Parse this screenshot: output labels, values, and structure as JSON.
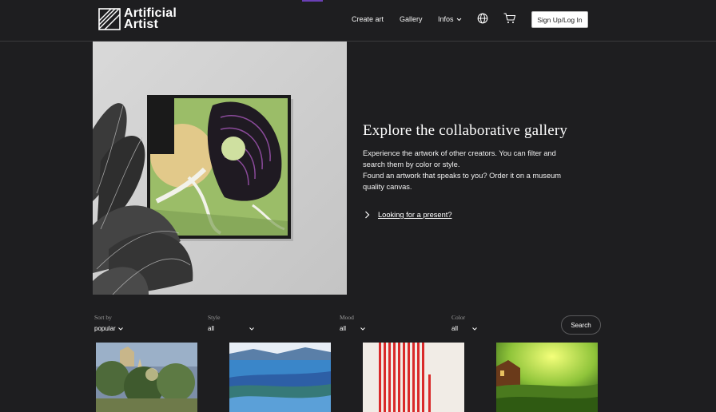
{
  "header": {
    "logo_line1": "Artificial",
    "logo_line2": "Artist",
    "nav": {
      "create": "Create art",
      "gallery": "Gallery",
      "infos": "Infos"
    },
    "signup": "Sign Up/Log In"
  },
  "hero": {
    "title": "Explore the collaborative gallery",
    "line1": "Experience the artwork of other creators. You can filter and search them by color or style.",
    "line2": "Found an artwork that speaks to you? Order it on a museum quality canvas.",
    "present_link": "Looking for a present?"
  },
  "filters": {
    "sort": {
      "label": "Sort by",
      "value": "popular"
    },
    "style": {
      "label": "Style",
      "value": "all"
    },
    "mood": {
      "label": "Mood",
      "value": "all"
    },
    "color": {
      "label": "Color",
      "value": "all"
    },
    "search": "Search"
  },
  "icons": {
    "logo": "artificial-artist-logo-icon",
    "globe": "globe-icon",
    "cart": "cart-icon",
    "chevron": "chevron-down-icon",
    "arrow": "chevron-right-icon"
  }
}
